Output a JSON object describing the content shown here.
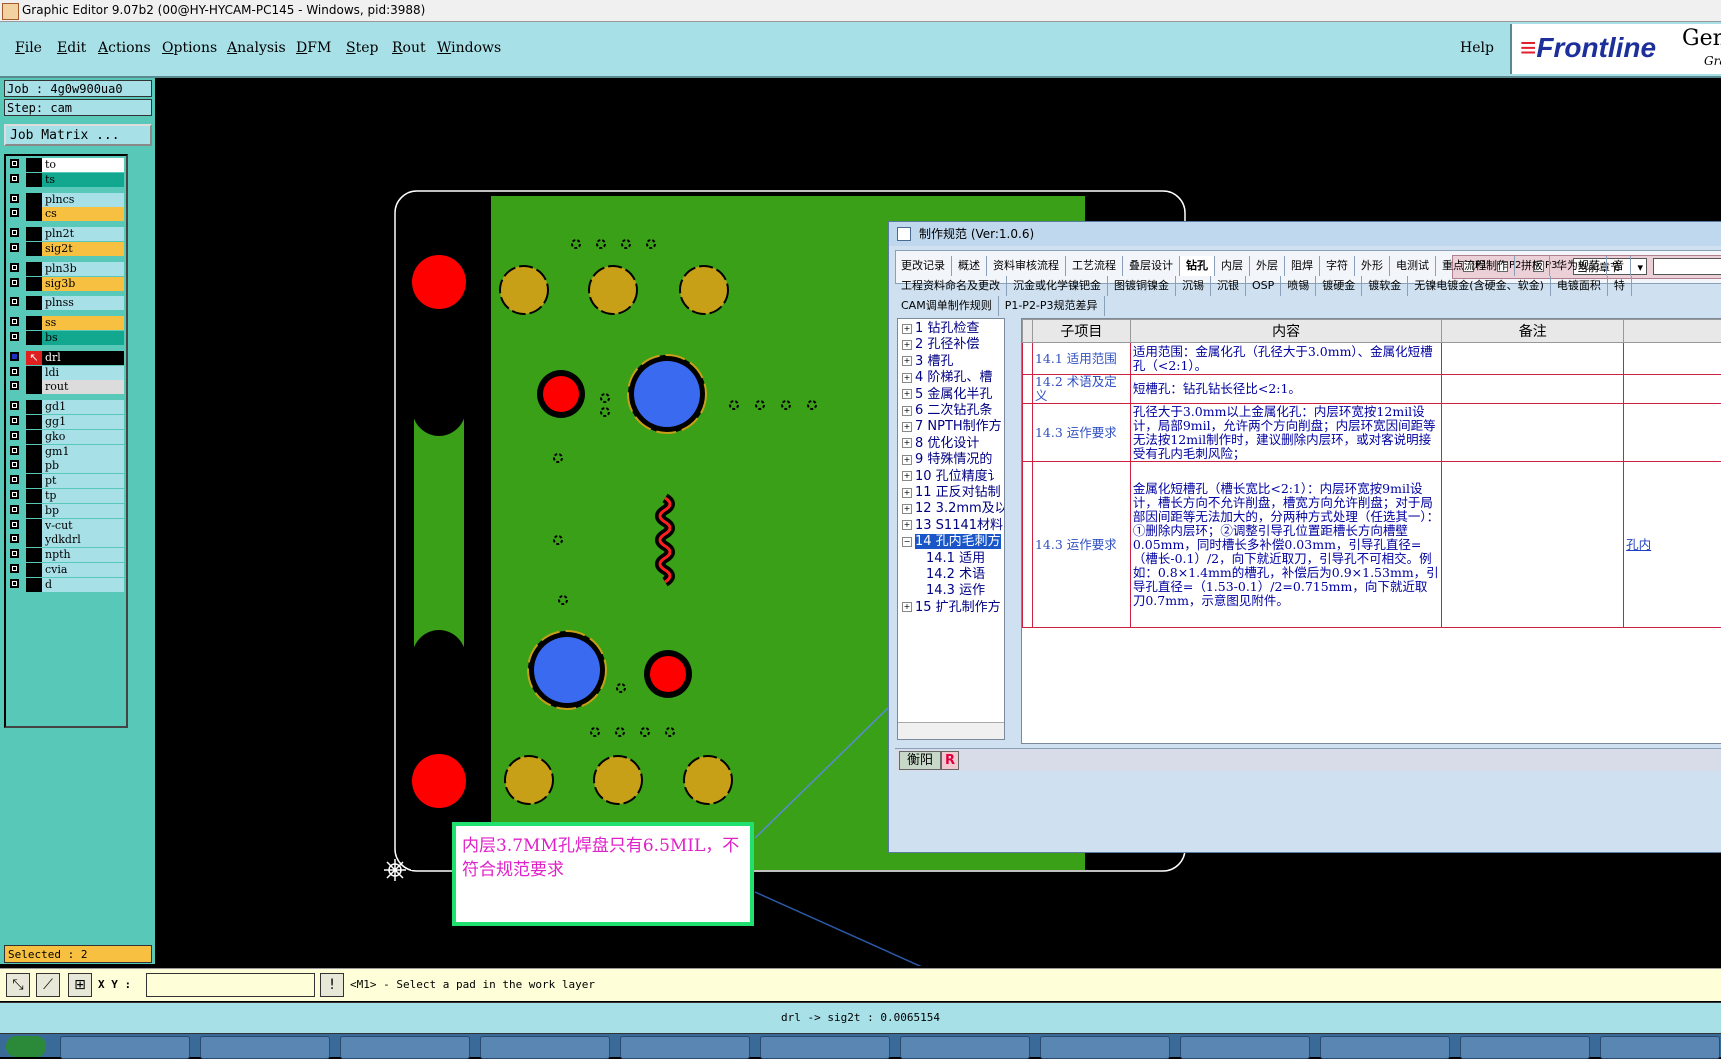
{
  "window": {
    "title": "Graphic Editor 9.07b2 (00@HY-HYCAM-PC145 - Windows, pid:3988)"
  },
  "menu": {
    "items": [
      {
        "label": "File",
        "accel": "F",
        "rest": "ile"
      },
      {
        "label": "Edit",
        "accel": "E",
        "rest": "dit"
      },
      {
        "label": "Actions",
        "accel": "A",
        "rest": "ctions"
      },
      {
        "label": "Options",
        "accel": "O",
        "rest": "ptions"
      },
      {
        "label": "Analysis",
        "accel": "A",
        "rest": "nalysis"
      },
      {
        "label": "DFM",
        "accel": "D",
        "rest": "FM"
      },
      {
        "label": "Step",
        "accel": "S",
        "rest": "tep"
      },
      {
        "label": "Rout",
        "accel": "R",
        "rest": "out"
      },
      {
        "label": "Windows",
        "accel": "W",
        "rest": "indows"
      }
    ],
    "help": "Help"
  },
  "logo": {
    "brand": "Frontline",
    "gen": "Gen",
    "gra": "Gra"
  },
  "left": {
    "job": "Job : 4g0w900ua0",
    "step": "Step: cam",
    "job_matrix": "Job Matrix ...",
    "layers": [
      {
        "name": "to",
        "color": "#ffffff",
        "checked": false
      },
      {
        "name": "ts",
        "color": "#12a890",
        "checked": false
      },
      {
        "name": "plncs",
        "color": "#a8e0e8",
        "checked": false
      },
      {
        "name": "cs",
        "color": "#f8c040",
        "checked": false
      },
      {
        "name": "pln2t",
        "color": "#a8e0e8",
        "checked": false
      },
      {
        "name": "sig2t",
        "color": "#f8c040",
        "checked": false
      },
      {
        "name": "pln3b",
        "color": "#a8e0e8",
        "checked": false
      },
      {
        "name": "sig3b",
        "color": "#f8c040",
        "checked": false
      },
      {
        "name": "plnss",
        "color": "#a8e0e8",
        "checked": false
      },
      {
        "name": "ss",
        "color": "#f8c040",
        "checked": false
      },
      {
        "name": "bs",
        "color": "#12a890",
        "checked": false
      },
      {
        "name": "drl",
        "color": "#a8e0e8",
        "checked": true
      },
      {
        "name": "ldi",
        "color": "#a8e0e8",
        "checked": false
      },
      {
        "name": "rout",
        "color": "#dcdcdc",
        "checked": false
      },
      {
        "name": "gd1",
        "color": "#a8e0e8",
        "checked": false
      },
      {
        "name": "gg1",
        "color": "#a8e0e8",
        "checked": false
      },
      {
        "name": "gko",
        "color": "#a8e0e8",
        "checked": false
      },
      {
        "name": "gm1",
        "color": "#a8e0e8",
        "checked": false
      },
      {
        "name": "pb",
        "color": "#a8e0e8",
        "checked": false
      },
      {
        "name": "pt",
        "color": "#a8e0e8",
        "checked": false
      },
      {
        "name": "tp",
        "color": "#a8e0e8",
        "checked": false
      },
      {
        "name": "bp",
        "color": "#a8e0e8",
        "checked": false
      },
      {
        "name": "v-cut",
        "color": "#a8e0e8",
        "checked": false
      },
      {
        "name": "ydkdrl",
        "color": "#a8e0e8",
        "checked": false
      },
      {
        "name": "npth",
        "color": "#a8e0e8",
        "checked": false
      },
      {
        "name": "cvia",
        "color": "#a8e0e8",
        "checked": false
      },
      {
        "name": "d",
        "color": "#a8e0e8",
        "checked": false
      }
    ],
    "selected": "Selected : 2"
  },
  "cmd": {
    "xy_label": "X Y :",
    "xy_value": "",
    "prompt": "<M1> - Select a pad in the work layer"
  },
  "status": {
    "text": "drl -> sig2t : 0.0065154"
  },
  "annotation": {
    "text": "内层3.7MM孔焊盘只有6.5MIL，不符合规范要求"
  },
  "dialog": {
    "title": "制作规范 (Ver:1.0.6)",
    "p1": "P1",
    "p2": "P2",
    "p3": "P3",
    "p3_checked": true,
    "chapter": "当前章节",
    "tabs_row1": [
      "更改记录",
      "概述",
      "资料审核流程",
      "工艺流程",
      "叠层设计",
      "钻孔",
      "内层",
      "外层",
      "阻焊",
      "字符",
      "外形",
      "电测试",
      "重点流程制作",
      "拼板",
      "华为规范",
      "音"
    ],
    "tabs_row2": [
      "工程资料命名及更改",
      "沉金或化学镍钯金",
      "图镀铜镍金",
      "沉锡",
      "沉银",
      "OSP",
      "喷锡",
      "镀硬金",
      "镀软金",
      "无镍电镀金(含硬金、软金)",
      "电镀面积",
      "特"
    ],
    "tabs_row3": [
      "CAM调单制作规则",
      "P1-P2-P3规范差异"
    ],
    "active_tab": "钻孔",
    "tree": [
      {
        "label": "1 钻孔检查",
        "sel": false
      },
      {
        "label": "2 孔径补偿",
        "sel": false
      },
      {
        "label": "3 槽孔",
        "sel": false
      },
      {
        "label": "4 阶梯孔、槽",
        "sel": false
      },
      {
        "label": "5 金属化半孔",
        "sel": false
      },
      {
        "label": "6 二次钻孔条",
        "sel": false
      },
      {
        "label": "7 NPTH制作方",
        "sel": false
      },
      {
        "label": "8 优化设计",
        "sel": false
      },
      {
        "label": "9 特殊情况的",
        "sel": false
      },
      {
        "label": "10 孔位精度讠",
        "sel": false
      },
      {
        "label": "11 正反对钻制",
        "sel": false
      },
      {
        "label": "12 3.2mm及以",
        "sel": false
      },
      {
        "label": "13 S1141材料",
        "sel": false
      },
      {
        "label": "14 孔内毛刺方",
        "sel": true
      },
      {
        "label": "14.1 适用",
        "sel": false,
        "child": true
      },
      {
        "label": "14.2 术语",
        "sel": false,
        "child": true
      },
      {
        "label": "14.3 运作",
        "sel": false,
        "child": true
      },
      {
        "label": "15 扩孔制作方",
        "sel": false
      }
    ],
    "table": {
      "headers": [
        "子项目",
        "内容",
        "备注"
      ],
      "rows": [
        {
          "cat": "14.1 适用范围",
          "content": "适用范围：金属化孔（孔径大于3.0mm）、金属化短槽孔（<2:1）。",
          "note": "",
          "extra": ""
        },
        {
          "cat": "14.2 术语及定义",
          "content": "短槽孔：钻孔钻长径比<2:1。",
          "note": "",
          "extra": ""
        },
        {
          "cat": "14.3 运作要求",
          "content": "孔径大于3.0mm以上金属化孔：内层环宽按12mil设计，局部9mil，允许两个方向削盘；内层环宽因间距等无法按12mil制作时，建议删除内层环，或对客说明接受有孔内毛刺风险；",
          "note": "",
          "extra": ""
        },
        {
          "cat": "14.3 运作要求",
          "content": "金属化短槽孔（槽长宽比<2:1）：内层环宽按9mil设计，槽长方向不允许削盘，槽宽方向允许削盘；对于局部因间距等无法加大的，分两种方式处理（任选其一）：①删除内层环；②调整引导孔位置距槽长方向槽壁0.05mm，同时槽长多补偿0.03mm，引导孔直径=（槽长-0.1）/2，向下就近取刀，引导孔不可相交。例如：0.8×1.4mm的槽孔，补偿后为0.9×1.53mm，引导孔直径=（1.53-0.1）/2=0.715mm，向下就近取刀0.7mm，示意图见附件。",
          "note": "",
          "extra": "孔内"
        }
      ]
    },
    "bottom_label": "衡阳",
    "bottom_r": "R"
  }
}
